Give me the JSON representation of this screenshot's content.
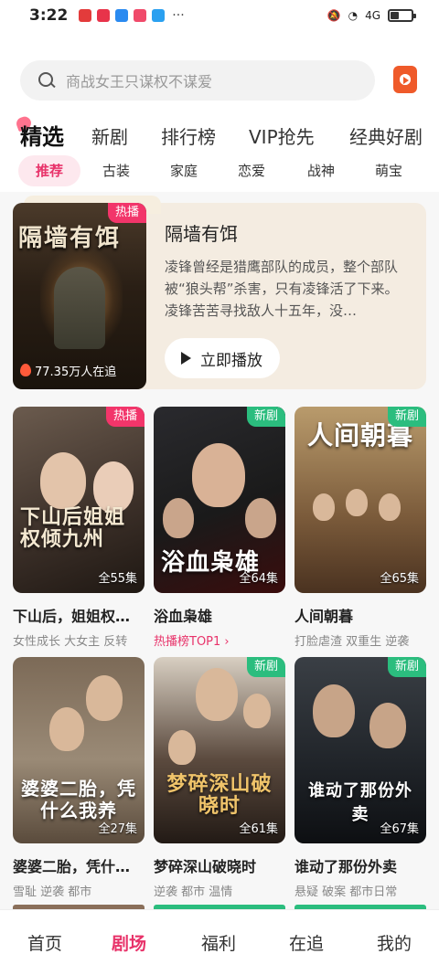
{
  "status_bar": {
    "time": "3:22",
    "dots": "···",
    "network": "4G"
  },
  "search": {
    "placeholder": "商战女王只谋权不谋爱"
  },
  "main_tabs": [
    "精选",
    "新剧",
    "排行榜",
    "VIP抢先",
    "经典好剧"
  ],
  "sub_tabs": [
    "推荐",
    "古装",
    "家庭",
    "恋爱",
    "战神",
    "萌宝"
  ],
  "featured": {
    "poster_title": "隔墙有饵",
    "badge": "热播",
    "watching": "77.35万人在追",
    "title": "隔墙有饵",
    "description": "凌锋曾经是猎鹰部队的成员，整个部队被“狼头帮”杀害，只有凌锋活了下来。凌锋苦苦寻找敌人十五年，没…",
    "play_label": "立即播放"
  },
  "cards": [
    {
      "poster_text": "下山后姐姐权倾九州",
      "badge": "热播",
      "episodes": "全55集",
      "title": "下山后，姐姐权…",
      "tags": "女性成长 大女主 反转"
    },
    {
      "poster_text": "浴血枭雄",
      "badge": "新剧",
      "episodes": "全64集",
      "title": "浴血枭雄",
      "tags": "热播榜TOP1 ›"
    },
    {
      "poster_text": "人间朝暮",
      "badge": "新剧",
      "episodes": "全65集",
      "title": "人间朝暮",
      "tags": "打脸虐渣 双重生 逆袭"
    },
    {
      "poster_text": "婆婆二胎，凭什么我养",
      "badge": "",
      "episodes": "全27集",
      "title": "婆婆二胎，凭什…",
      "tags": "雪耻 逆袭 都市"
    },
    {
      "poster_text": "梦碎深山破晓时",
      "badge": "新剧",
      "episodes": "全61集",
      "title": "梦碎深山破晓时",
      "tags": "逆袭 都市 温情"
    },
    {
      "poster_text": "谁动了那份外卖",
      "badge": "新剧",
      "episodes": "全67集",
      "title": "谁动了那份外卖",
      "tags": "悬疑 破案 都市日常"
    }
  ],
  "bottom_nav": [
    "首页",
    "剧场",
    "福利",
    "在追",
    "我的"
  ],
  "colors": {
    "accent": "#e8336a",
    "hot_badge": "#f2356a",
    "new_badge": "#2bbd7e"
  }
}
